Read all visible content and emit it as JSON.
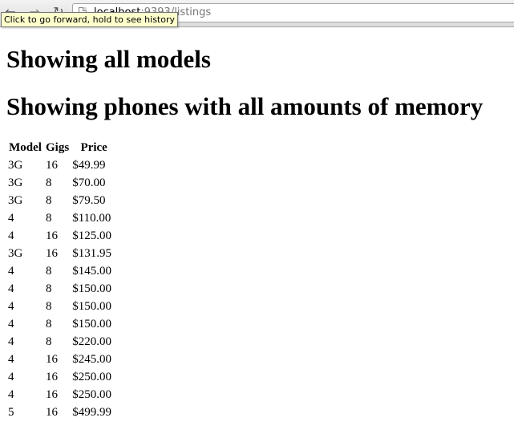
{
  "browser": {
    "url_host": "localhost",
    "url_rest": ":9393/listings",
    "tooltip": "Click to go forward, hold to see history",
    "back_icon": "arrow-left",
    "forward_icon": "arrow-right",
    "reload_icon": "reload"
  },
  "page": {
    "heading_1": "Showing all models",
    "heading_2": "Showing phones with all amounts of memory",
    "table": {
      "headers": [
        "Model",
        "Gigs",
        "Price"
      ],
      "rows": [
        [
          "3G",
          "16",
          "$49.99"
        ],
        [
          "3G",
          "8",
          "$70.00"
        ],
        [
          "3G",
          "8",
          "$79.50"
        ],
        [
          "4",
          "8",
          "$110.00"
        ],
        [
          "4",
          "16",
          "$125.00"
        ],
        [
          "3G",
          "16",
          "$131.95"
        ],
        [
          "4",
          "8",
          "$145.00"
        ],
        [
          "4",
          "8",
          "$150.00"
        ],
        [
          "4",
          "8",
          "$150.00"
        ],
        [
          "4",
          "8",
          "$150.00"
        ],
        [
          "4",
          "8",
          "$220.00"
        ],
        [
          "4",
          "16",
          "$245.00"
        ],
        [
          "4",
          "16",
          "$250.00"
        ],
        [
          "4",
          "16",
          "$250.00"
        ],
        [
          "5",
          "16",
          "$499.99"
        ]
      ]
    }
  }
}
